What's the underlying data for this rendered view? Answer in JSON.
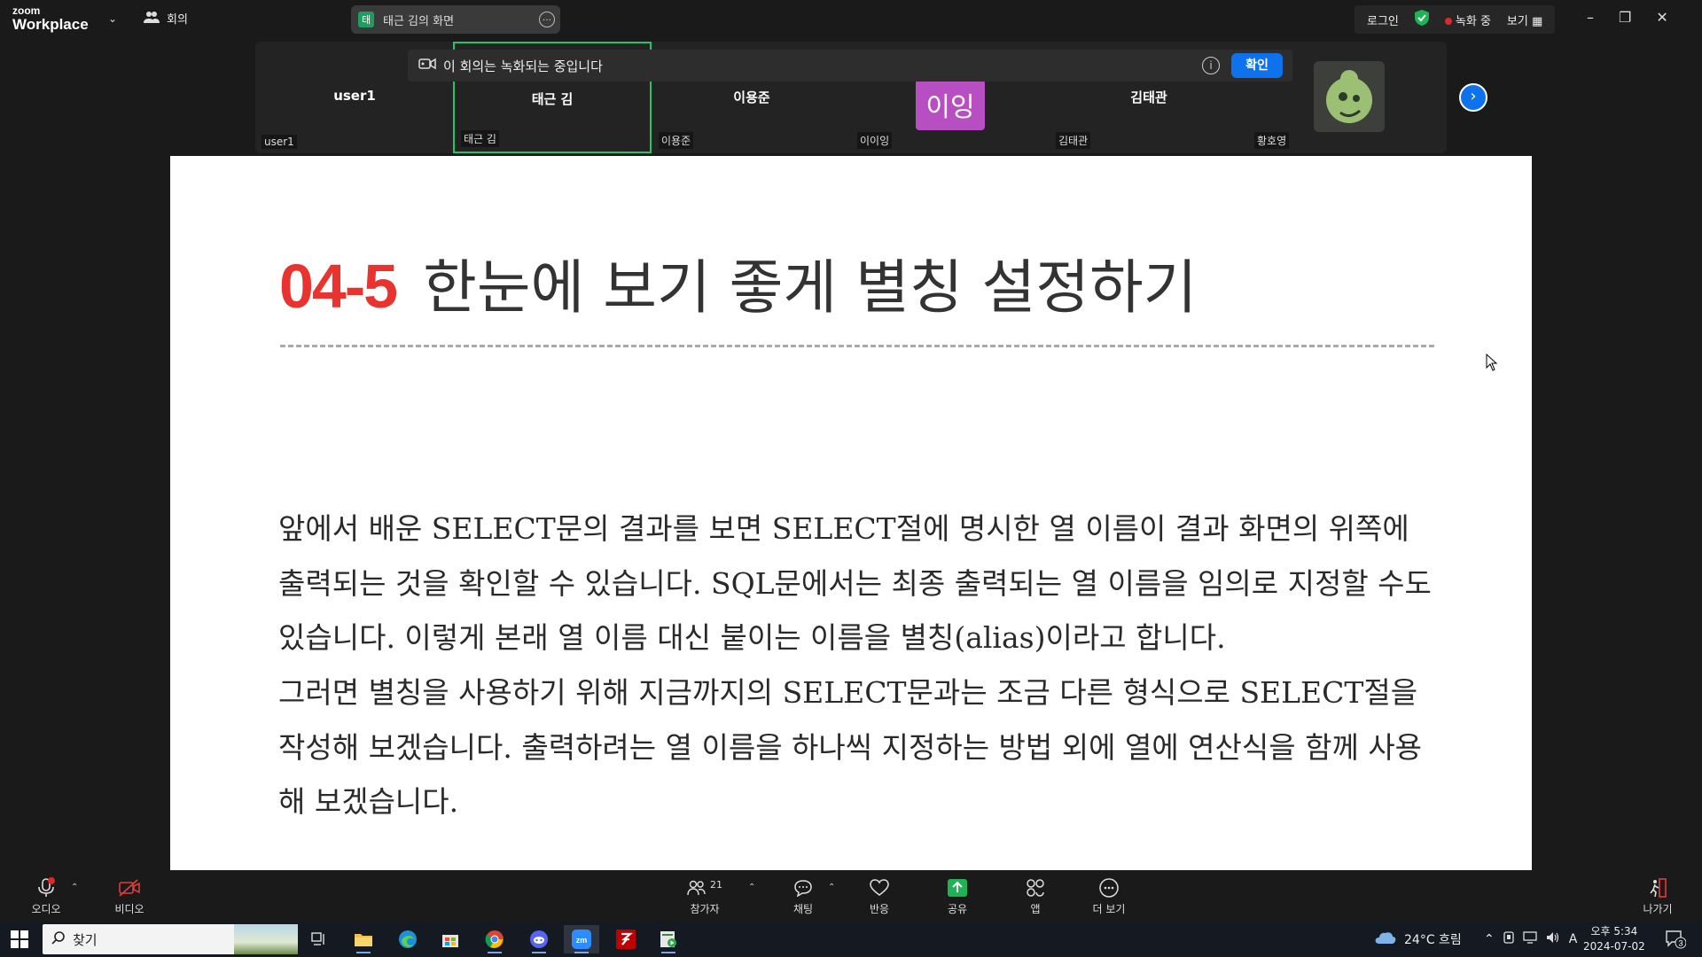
{
  "app": {
    "logo_top": "zoom",
    "logo_bottom": "Workplace",
    "meeting_label": "회의",
    "share_title": "태근 김의 화면",
    "share_tag": "태",
    "login": "로그인",
    "recording": "녹화 중",
    "view": "보기"
  },
  "banner": {
    "text": "이 회의는 녹화되는 중입니다",
    "confirm": "확인"
  },
  "participants": [
    {
      "center": "user1",
      "label": "user1"
    },
    {
      "center": "태근 김",
      "label": "태근 김"
    },
    {
      "center": "이용준",
      "label": "이용준"
    },
    {
      "center": "이잉",
      "label": "이이잉"
    },
    {
      "center": "김태관",
      "label": "김태관"
    },
    {
      "center": "",
      "label": "황호영"
    }
  ],
  "slide": {
    "number": "04-5",
    "title": "한눈에 보기 좋게 별칭 설정하기",
    "paragraph1": "앞에서 배운 SELECT문의 결과를 보면 SELECT절에 명시한 열 이름이 결과 화면의 위쪽에 출력되는 것을 확인할 수 있습니다. SQL문에서는 최종 출력되는 열 이름을 임의로 지정할 수도 있습니다. 이렇게 본래 열 이름 대신 붙이는 이름을 별칭(alias)이라고 합니다.",
    "paragraph2": "그러면 별칭을 사용하기 위해 지금까지의 SELECT문과는 조금 다른 형식으로 SELECT절을 작성해 보겠습니다. 출력하려는 열 이름을 하나씩 지정하는 방법 외에 열에 연산식을 함께 사용해 보겠습니다."
  },
  "controls": {
    "audio": "오디오",
    "video": "비디오",
    "participants": "참가자",
    "participant_count": "21",
    "chat": "채팅",
    "reactions": "반응",
    "share": "공유",
    "apps": "앱",
    "more": "더 보기",
    "leave": "나가기"
  },
  "taskbar": {
    "search": "찾기",
    "weather": "24°C 흐림",
    "ime": "A",
    "time": "오후 5:34",
    "date": "2024-07-02",
    "notifications": "3"
  },
  "colors": {
    "accent": "#0e72ed",
    "active_speaker": "#1fc866",
    "slide_number": "#e8332f",
    "avatar_bg": "#b74ec1",
    "recording_dot": "#e02828"
  }
}
